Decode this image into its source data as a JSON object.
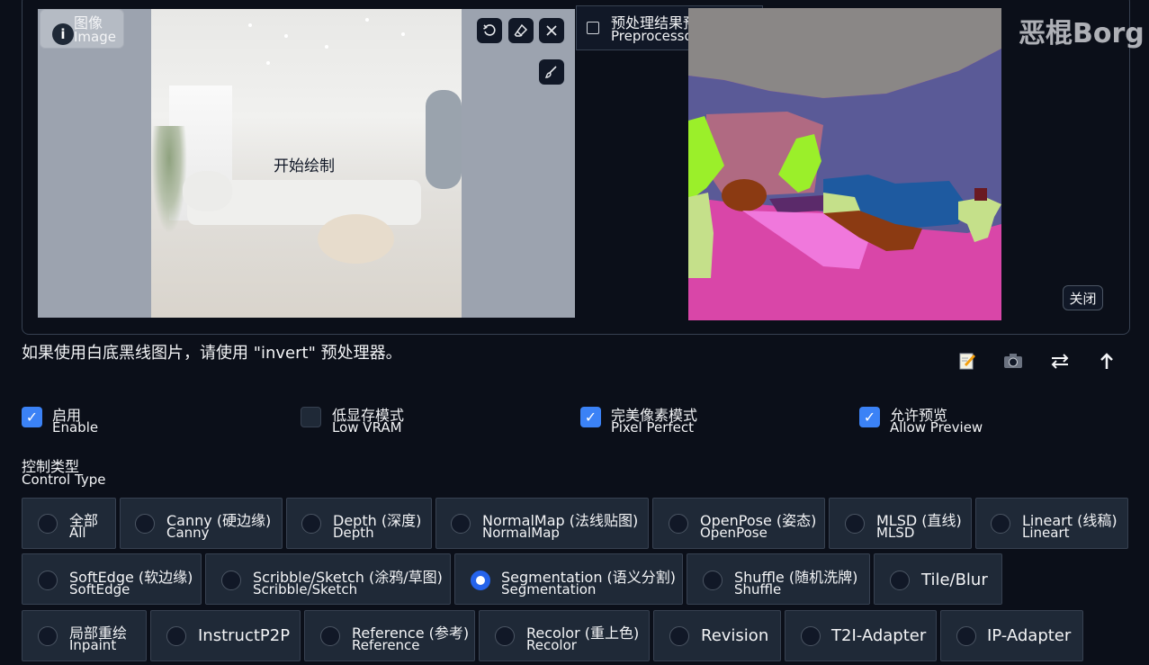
{
  "image_panel": {
    "label_cn": "图像",
    "label_en": "Image",
    "start_drawing": "开始绘制",
    "tools": [
      "undo-icon",
      "eraser-icon",
      "close-icon",
      "brush-icon"
    ]
  },
  "preview_panel": {
    "label_cn": "预处理结果预览",
    "label_en": "Preprocessor Preview",
    "close_button": "关闭"
  },
  "watermark": "恶棍Borg",
  "hint": "如果使用白底黑线图片，请使用 \"invert\" 预处理器。",
  "action_icons": [
    "edit-icon",
    "camera-icon",
    "swap-icon",
    "upload-arrow-icon"
  ],
  "options": [
    {
      "cn": "启用",
      "en": "Enable",
      "checked": true
    },
    {
      "cn": "低显存模式",
      "en": "Low VRAM",
      "checked": false
    },
    {
      "cn": "完美像素模式",
      "en": "Pixel Perfect",
      "checked": true
    },
    {
      "cn": "允许预览",
      "en": "Allow Preview",
      "checked": true
    }
  ],
  "control_type": {
    "label_cn": "控制类型",
    "label_en": "Control Type",
    "rows": [
      [
        {
          "cn": "全部",
          "en": "All"
        },
        {
          "cn": "Canny (硬边缘)",
          "en": "Canny"
        },
        {
          "cn": "Depth (深度)",
          "en": "Depth"
        },
        {
          "cn": "NormalMap (法线贴图)",
          "en": "NormalMap"
        },
        {
          "cn": "OpenPose (姿态)",
          "en": "OpenPose"
        },
        {
          "cn": "MLSD (直线)",
          "en": "MLSD"
        },
        {
          "cn": "Lineart (线稿)",
          "en": "Lineart"
        }
      ],
      [
        {
          "cn": "SoftEdge (软边缘)",
          "en": "SoftEdge"
        },
        {
          "cn": "Scribble/Sketch (涂鸦/草图)",
          "en": "Scribble/Sketch"
        },
        {
          "cn": "Segmentation (语义分割)",
          "en": "Segmentation",
          "selected": true
        },
        {
          "cn": "Shuffle (随机洗牌)",
          "en": "Shuffle"
        },
        {
          "single": "Tile/Blur"
        }
      ],
      [
        {
          "cn": "局部重绘",
          "en": "Inpaint"
        },
        {
          "single": "InstructP2P"
        },
        {
          "cn": "Reference (参考)",
          "en": "Reference"
        },
        {
          "cn": "Recolor (重上色)",
          "en": "Recolor"
        },
        {
          "single": "Revision"
        },
        {
          "single": "T2I-Adapter"
        },
        {
          "single": "IP-Adapter"
        }
      ]
    ]
  },
  "colors": {
    "accent": "#3b82f6",
    "radio_selected": "#2563eb",
    "background": "#0b0f19",
    "tile": "#1f2937"
  }
}
